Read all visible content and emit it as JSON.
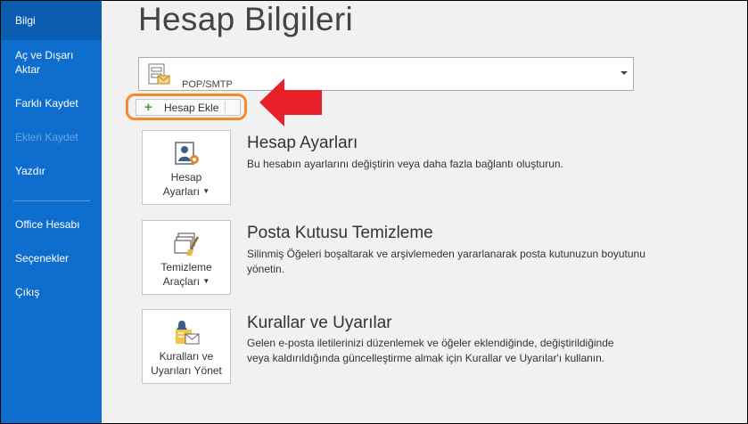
{
  "sidebar": {
    "items": [
      {
        "label": "Bilgi"
      },
      {
        "label": "Aç ve Dışarı Aktar"
      },
      {
        "label": "Farklı Kaydet"
      },
      {
        "label": "Ekleri Kaydet"
      },
      {
        "label": "Yazdır"
      },
      {
        "label": "Office Hesabı"
      },
      {
        "label": "Seçenekler"
      },
      {
        "label": "Çıkış"
      }
    ],
    "selected": "Bilgi",
    "disabled": "Ekleri Kaydet"
  },
  "main": {
    "title": "Hesap Bilgileri",
    "account_selector": {
      "value": "POP/SMTP",
      "icon": "mailbox-icon"
    },
    "add_account_label": "Hesap Ekle",
    "sections": [
      {
        "tile_label_1": "Hesap",
        "tile_label_2": "Ayarları",
        "icon": "account-settings-icon",
        "title": "Hesap Ayarları",
        "description": "Bu hesabın ayarlarını değiştirin veya daha fazla bağlantı oluşturun."
      },
      {
        "tile_label_1": "Temizleme",
        "tile_label_2": "Araçları",
        "icon": "cleanup-tools-icon",
        "title": "Posta Kutusu Temizleme",
        "description": "Silinmiş Öğeleri boşaltarak ve arşivlemeden yararlanarak posta kutunuzun boyutunu yönetin."
      },
      {
        "tile_label_1": "Kuralları ve",
        "tile_label_2": "Uyarıları Yönet",
        "icon": "rules-alerts-icon",
        "title": "Kurallar ve Uyarılar",
        "description": "Gelen e-posta iletilerinizi düzenlemek ve öğeler eklendiğinde, değiştirildiğinde veya kaldırıldığında güncelleştirme almak için Kurallar ve Uyarılar'ı kullanın."
      }
    ]
  },
  "colors": {
    "sidebar": "#0f6ecd",
    "highlight": "#f28a2e",
    "arrow": "#e8202a"
  }
}
